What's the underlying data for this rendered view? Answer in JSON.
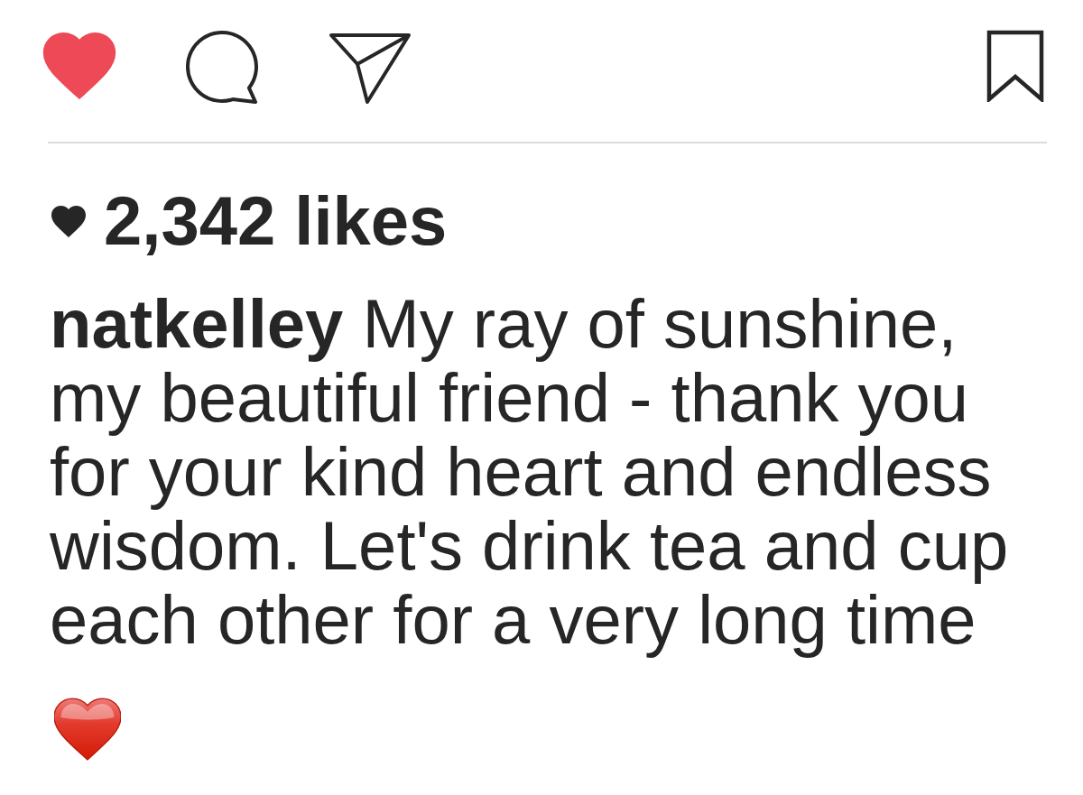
{
  "actions": {
    "liked": true
  },
  "likes": {
    "count": "2,342 likes"
  },
  "caption": {
    "username": "natkelley",
    "text": "My ray of sunshine, my beautiful friend - thank you for your kind heart and endless wisdom. Let's drink tea and cup each other for a very long time"
  }
}
